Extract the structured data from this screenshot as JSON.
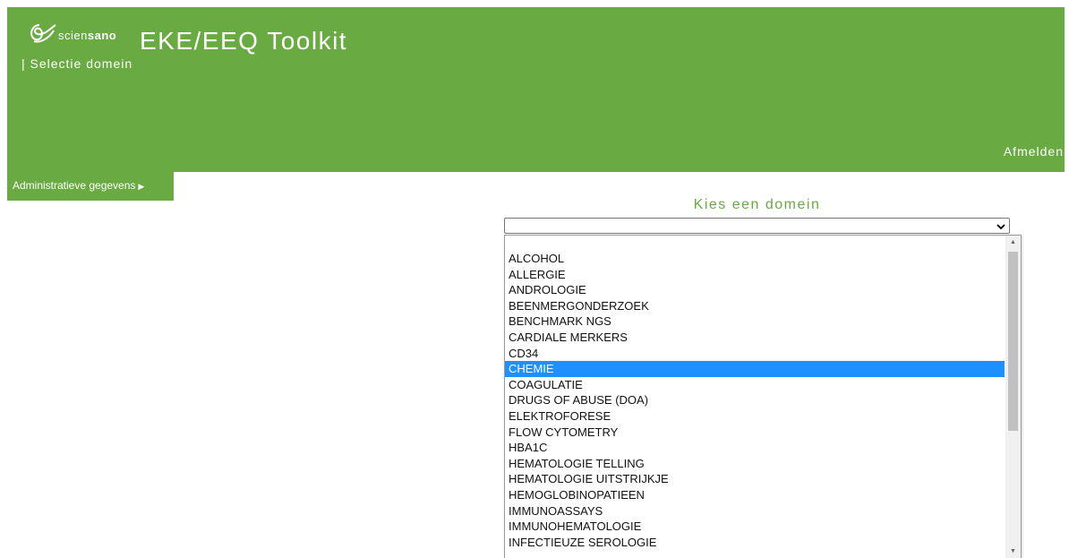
{
  "header": {
    "logo_prefix": "scien",
    "logo_bold": "sano",
    "app_title": "EKE/EEQ Toolkit",
    "subtitle": "| Selectie domein",
    "logout_label": "Afmelden",
    "background_color": "#6aaa42"
  },
  "nav": {
    "admin_label": "Administratieve gegevens",
    "admin_icon": "triangle-right-icon"
  },
  "main": {
    "domain_label": "Kies een domein",
    "select_value": "",
    "options": [
      "",
      "ALCOHOL",
      "ALLERGIE",
      "ANDROLOGIE",
      "BEENMERGONDERZOEK",
      "BENCHMARK NGS",
      "CARDIALE MERKERS",
      "CD34",
      "CHEMIE",
      "COAGULATIE",
      "DRUGS OF ABUSE (DOA)",
      "ELEKTROFORESE",
      "FLOW CYTOMETRY",
      "HBA1C",
      "HEMATOLOGIE TELLING",
      "HEMATOLOGIE UITSTRIJKJE",
      "HEMOGLOBINOPATIEEN",
      "IMMUNOASSAYS",
      "IMMUNOHEMATOLOGIE",
      "INFECTIEUZE SEROLOGIE"
    ],
    "highlighted_option": "CHEMIE",
    "highlight_color": "#1e90ff"
  }
}
